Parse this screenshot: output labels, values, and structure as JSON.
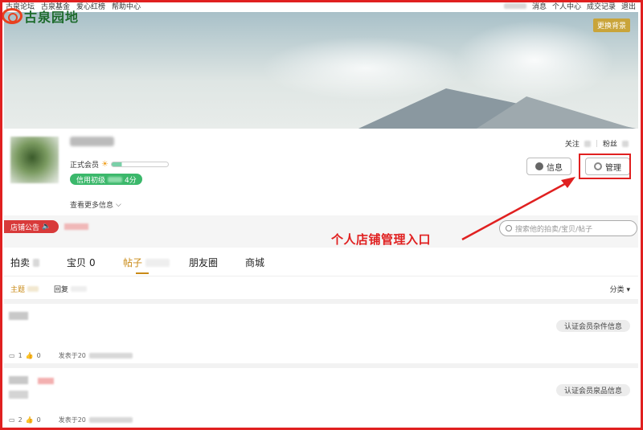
{
  "topbar": {
    "left_items": [
      "古泉论坛",
      "古泉基金",
      "爱心红榜",
      "帮助中心"
    ],
    "right_items": [
      "消息",
      "个人中心",
      "成交记录",
      "退出"
    ]
  },
  "logo": {
    "text": "古泉园地"
  },
  "banner": {
    "change_bg_label": "更换背景"
  },
  "profile": {
    "member_label": "正式会员",
    "credit_label": "信用初级",
    "credit_suffix": "4分",
    "more_info_label": "查看更多信息",
    "follow_label": "关注",
    "fans_label": "粉丝",
    "info_button": "信息",
    "manage_button": "管理"
  },
  "notice": {
    "tag_label": "店铺公告"
  },
  "search": {
    "placeholder": "搜索他的拍卖/宝贝/帖子"
  },
  "annotation": {
    "text": "个人店铺管理入口",
    "color": "#e02020"
  },
  "tabs": [
    {
      "label": "拍卖",
      "count": ""
    },
    {
      "label": "宝贝",
      "count": "0"
    },
    {
      "label": "帖子",
      "count": ""
    },
    {
      "label": "朋友圈",
      "count": ""
    },
    {
      "label": "商城",
      "count": ""
    }
  ],
  "subtabs": {
    "topic": "主题",
    "reply": "回复",
    "sort": "分类"
  },
  "posts": [
    {
      "tag": "认证会员杂件信息",
      "comments": "1",
      "likes": "0",
      "posted_prefix": "发表于20"
    },
    {
      "tag": "认证会员泉品信息",
      "comments": "2",
      "likes": "0",
      "posted_prefix": "发表于20"
    }
  ],
  "colors": {
    "accent": "#c98a16",
    "credit": "#3bb86b",
    "notice": "#d83a3a",
    "highlight": "#e02020"
  }
}
